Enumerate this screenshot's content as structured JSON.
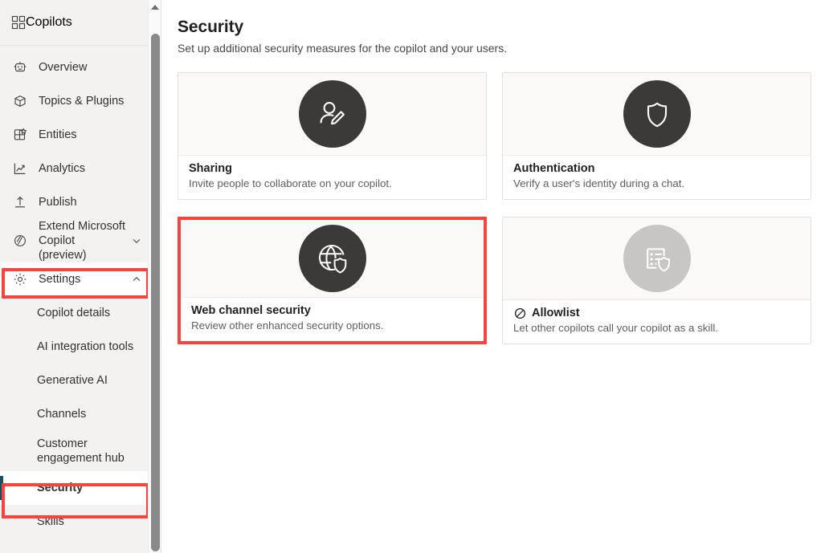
{
  "sidebar": {
    "header": {
      "label": "Copilots",
      "icon": "grid-icon"
    },
    "items": [
      {
        "label": "Overview",
        "icon": "robot-icon",
        "expandable": false
      },
      {
        "label": "Topics & Plugins",
        "icon": "box-icon",
        "expandable": false
      },
      {
        "label": "Entities",
        "icon": "entities-icon",
        "expandable": false
      },
      {
        "label": "Analytics",
        "icon": "analytics-icon",
        "expandable": false
      },
      {
        "label": "Publish",
        "icon": "publish-icon",
        "expandable": false
      },
      {
        "label": "Extend Microsoft Copilot (preview)",
        "icon": "extend-icon",
        "expandable": true,
        "chevron": "chevron-down-icon"
      },
      {
        "label": "Settings",
        "icon": "gear-icon",
        "expandable": true,
        "chevron": "chevron-up-icon",
        "highlighted": true
      }
    ],
    "settings_subitems": [
      {
        "label": "Copilot details",
        "selected": false
      },
      {
        "label": "AI integration tools",
        "selected": false
      },
      {
        "label": "Generative AI",
        "selected": false
      },
      {
        "label": "Channels",
        "selected": false
      },
      {
        "label": "Customer engagement hub",
        "selected": false
      },
      {
        "label": "Security",
        "selected": true,
        "highlighted": true
      },
      {
        "label": "Skills",
        "selected": false
      }
    ],
    "scrollbar": {
      "up_arrow": "scroll-up-arrow-icon"
    }
  },
  "main": {
    "title": "Security",
    "subtitle": "Set up additional security measures for the copilot and your users.",
    "cards": [
      {
        "title": "Sharing",
        "description": "Invite people to collaborate on your copilot.",
        "icon": "user-edit-icon",
        "icon_state": "active",
        "highlighted": false,
        "has_title_icon": false
      },
      {
        "title": "Authentication",
        "description": "Verify a user's identity during a chat.",
        "icon": "shield-icon",
        "icon_state": "active",
        "highlighted": false,
        "has_title_icon": false
      },
      {
        "title": "Web channel security",
        "description": "Review other enhanced security options.",
        "icon": "globe-shield-icon",
        "icon_state": "active",
        "highlighted": true,
        "has_title_icon": false
      },
      {
        "title": "Allowlist",
        "description": "Let other copilots call your copilot as a skill.",
        "icon": "list-shield-icon",
        "icon_state": "disabled",
        "highlighted": false,
        "has_title_icon": true,
        "title_icon": "blocked-icon"
      }
    ]
  },
  "colors": {
    "accent_red_highlight": "#f8443c",
    "selected_indicator": "#174f5f",
    "sidebar_bg": "#f3f2f1",
    "icon_circle": "#3b3a39",
    "icon_circle_disabled": "#c8c6c4"
  }
}
